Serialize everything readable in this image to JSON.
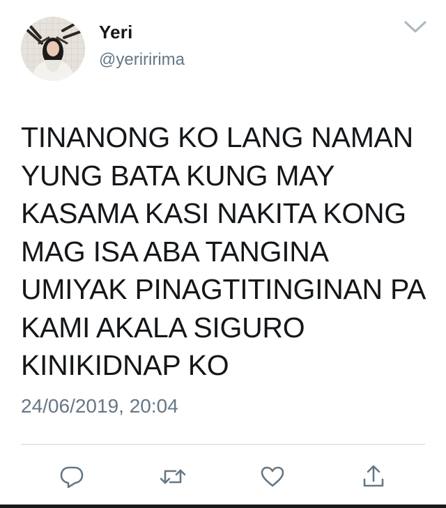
{
  "tweet": {
    "display_name": "Yeri",
    "handle": "@yeriririma",
    "text": "TINANONG KO LANG NAMAN\nYUNG BATA KUNG MAY\nKASAMA KASI NAKITA KONG\nMAG ISA ABA TANGINA\nUMIYAK PINAGTITINGINAN PA\nKAMI AKALA SIGURO\nKINIKIDNAP KO",
    "timestamp": "24/06/2019, 20:04"
  },
  "actions": {
    "reply_icon": "reply-icon",
    "retweet_icon": "retweet-icon",
    "like_icon": "heart-icon",
    "share_icon": "share-icon"
  },
  "colors": {
    "text": "#14171a",
    "secondary": "#657786",
    "icon": "#657786",
    "divider": "#cdd5dc"
  }
}
